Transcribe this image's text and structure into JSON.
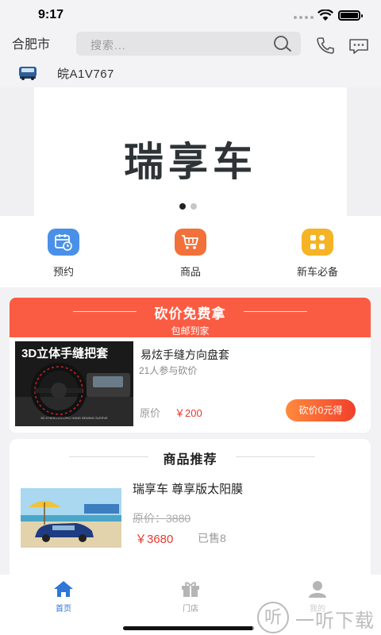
{
  "status_bar": {
    "time": "9:17"
  },
  "header": {
    "city": "合肥市",
    "search_placeholder": "搜索..."
  },
  "vehicle": {
    "plate": "皖A1V767"
  },
  "banner": {
    "brand_text": "瑞享车",
    "page_count": 2,
    "active_page": 1
  },
  "quick_actions": [
    {
      "label": "预约",
      "icon": "calendar-clock-icon",
      "color": "#4a90e8"
    },
    {
      "label": "商品",
      "icon": "shopping-cart-icon",
      "color": "#f2713a"
    },
    {
      "label": "新车必备",
      "icon": "grid-apps-icon",
      "color": "#f5b325"
    }
  ],
  "bargain": {
    "title": "砍价免费拿",
    "subtitle": "包邮到家",
    "product": {
      "image_text": "3D立体手缝把套",
      "image_caption": "3D STEREOSCOPIC HAND SEWING SLEEVE",
      "title": "易炫手缝方向盘套",
      "participants": "21人参与砍价",
      "orig_label": "原价",
      "price": "￥200",
      "button": "砍价0元得"
    }
  },
  "recommend": {
    "title": "商品推荐",
    "product": {
      "title": "瑞享车  尊享版太阳膜",
      "orig_price": "原价：3880",
      "price": "￥3680",
      "sold": "已售8"
    }
  },
  "tabs": [
    {
      "label": "首页",
      "icon": "home-icon",
      "active": true
    },
    {
      "label": "门店",
      "icon": "gift-store-icon",
      "active": false
    },
    {
      "label": "我的",
      "icon": "user-icon",
      "active": false
    }
  ],
  "watermark": {
    "icon_char": "听",
    "text": "一听下载"
  },
  "colors": {
    "accent": "#2f76d6",
    "bargain_header": "#fa5c43",
    "price": "#e63a2e"
  }
}
